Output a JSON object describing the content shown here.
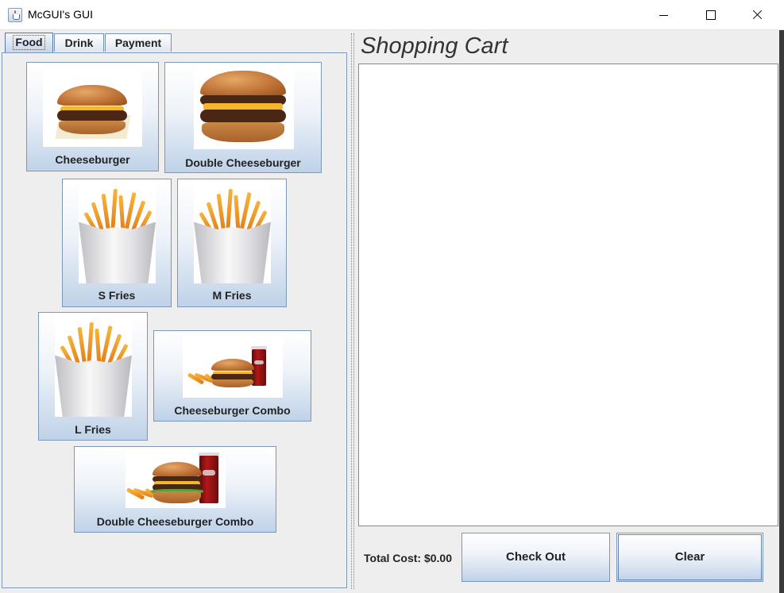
{
  "window": {
    "title": "McGUI's GUI",
    "icon": "java-cup-icon"
  },
  "tabs": [
    {
      "label": "Food",
      "selected": true
    },
    {
      "label": "Drink",
      "selected": false
    },
    {
      "label": "Payment",
      "selected": false
    }
  ],
  "menu_items": [
    {
      "label": "Cheeseburger",
      "image": "cheeseburger-image"
    },
    {
      "label": "Double Cheeseburger",
      "image": "double-cheeseburger-image"
    },
    {
      "label": "S Fries",
      "image": "fries-image"
    },
    {
      "label": "M Fries",
      "image": "fries-image"
    },
    {
      "label": "L Fries",
      "image": "fries-image"
    },
    {
      "label": "Cheeseburger Combo",
      "image": "cheeseburger-combo-image"
    },
    {
      "label": "Double Cheeseburger Combo",
      "image": "double-cheeseburger-combo-image"
    }
  ],
  "cart": {
    "title": "Shopping Cart",
    "items": [],
    "total_label": "Total Cost: $0.00"
  },
  "actions": {
    "checkout_label": "Check Out",
    "clear_label": "Clear"
  },
  "colors": {
    "button_gradient_top": "#ffffff",
    "button_gradient_bottom": "#bfd2e8",
    "panel_background": "#eeeeee"
  }
}
